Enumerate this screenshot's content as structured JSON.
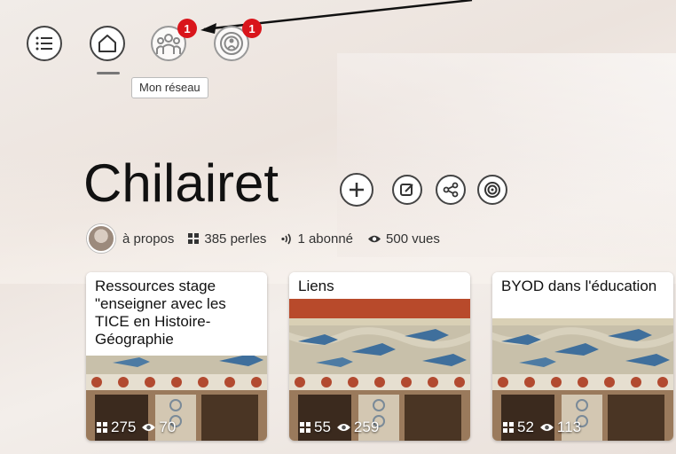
{
  "nav": {
    "menu_icon": "menu-icon",
    "home_icon": "home-icon",
    "network_icon": "people-icon",
    "subscriptions_icon": "broadcast-icon",
    "network_badge": "1",
    "subscriptions_badge": "1",
    "tooltip": "Mon réseau"
  },
  "page": {
    "title": "Chilairet",
    "actions": [
      "plus-icon",
      "edit-icon",
      "share-icon",
      "target-icon"
    ]
  },
  "stats": {
    "about": "à propos",
    "perles": "385 perles",
    "abonne": "1 abonné",
    "vues": "500 vues"
  },
  "cards": [
    {
      "title": "Ressources stage \"enseigner avec les TICE en Histoire-Géographie",
      "perles": "275",
      "vues": "70"
    },
    {
      "title": "Liens",
      "perles": "55",
      "vues": "259"
    },
    {
      "title": "BYOD dans l'éducation",
      "perles": "52",
      "vues": "113"
    }
  ],
  "colors": {
    "badge": "#d9151b",
    "fresco_blue": "#3f6f9c",
    "fresco_wall": "#c9c0ac"
  }
}
